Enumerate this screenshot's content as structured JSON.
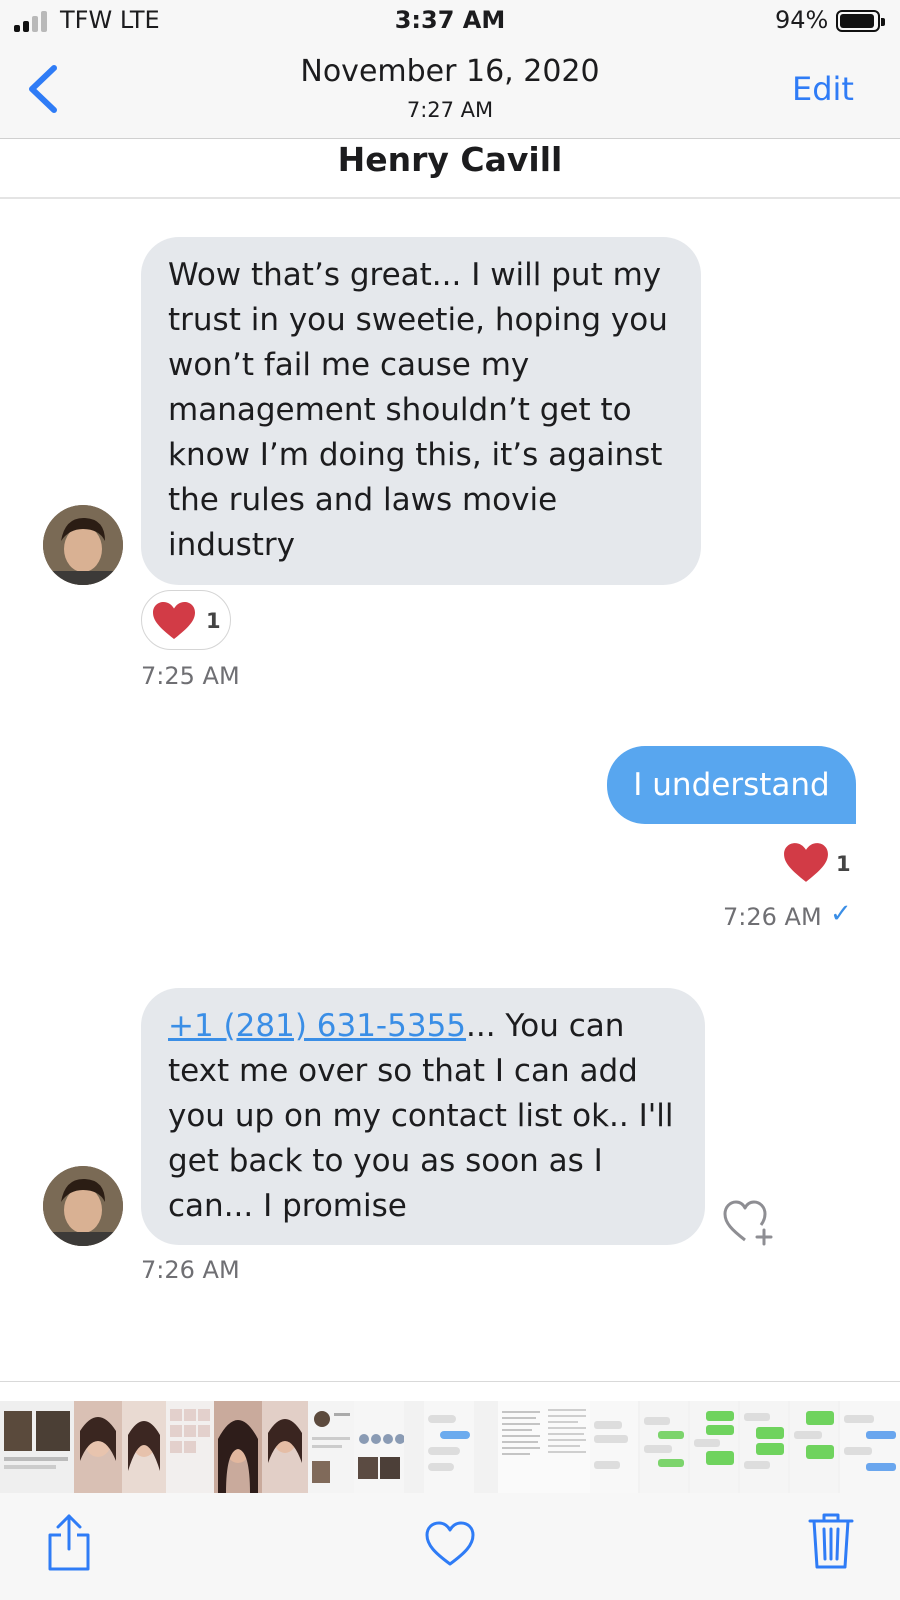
{
  "status_bar": {
    "carrier": "TFW   LTE",
    "time": "3:37 AM",
    "battery": "94%",
    "battery_level": 0.94
  },
  "nav": {
    "date": "November 16, 2020",
    "time": "7:27 AM",
    "edit_label": "Edit",
    "back_icon": "chevron-left-icon"
  },
  "contact": {
    "name": "Henry Cavill"
  },
  "messages": [
    {
      "direction": "incoming",
      "lines": [
        "Wow that’s great... I will put my",
        "trust in you sweetie, hoping you",
        "won’t fail me cause my",
        "management shouldn’t get to",
        "know I’m doing this, it’s against",
        "the rules and laws movie",
        "industry"
      ],
      "reaction": {
        "icon": "heart-icon",
        "count": "1"
      },
      "time": "7:25 AM"
    },
    {
      "direction": "outgoing",
      "text": "I understand",
      "reaction": {
        "icon": "heart-icon",
        "count": "1"
      },
      "time": "7:26 AM",
      "status_icon": "checkmark-icon",
      "status_glyph": "✓"
    },
    {
      "direction": "incoming",
      "link": "+1 (281) 631-5355",
      "first_line_rest": "... You can",
      "lines": [
        "text me over so that I can add",
        "you up on my contact list ok.. I'll",
        "get back to you as soon as  I",
        "can... I promise"
      ],
      "react_button_icon": "heart-plus-icon",
      "time": "7:26 AM"
    }
  ],
  "toolbar": {
    "share_icon": "share-icon",
    "favorite_icon": "heart-outline-icon",
    "delete_icon": "trash-icon"
  },
  "colors": {
    "accent": "#2f7cf6",
    "outgoing_bubble": "#58a6ef",
    "incoming_bubble": "#e5e8ec",
    "heart": "#d23b46"
  }
}
